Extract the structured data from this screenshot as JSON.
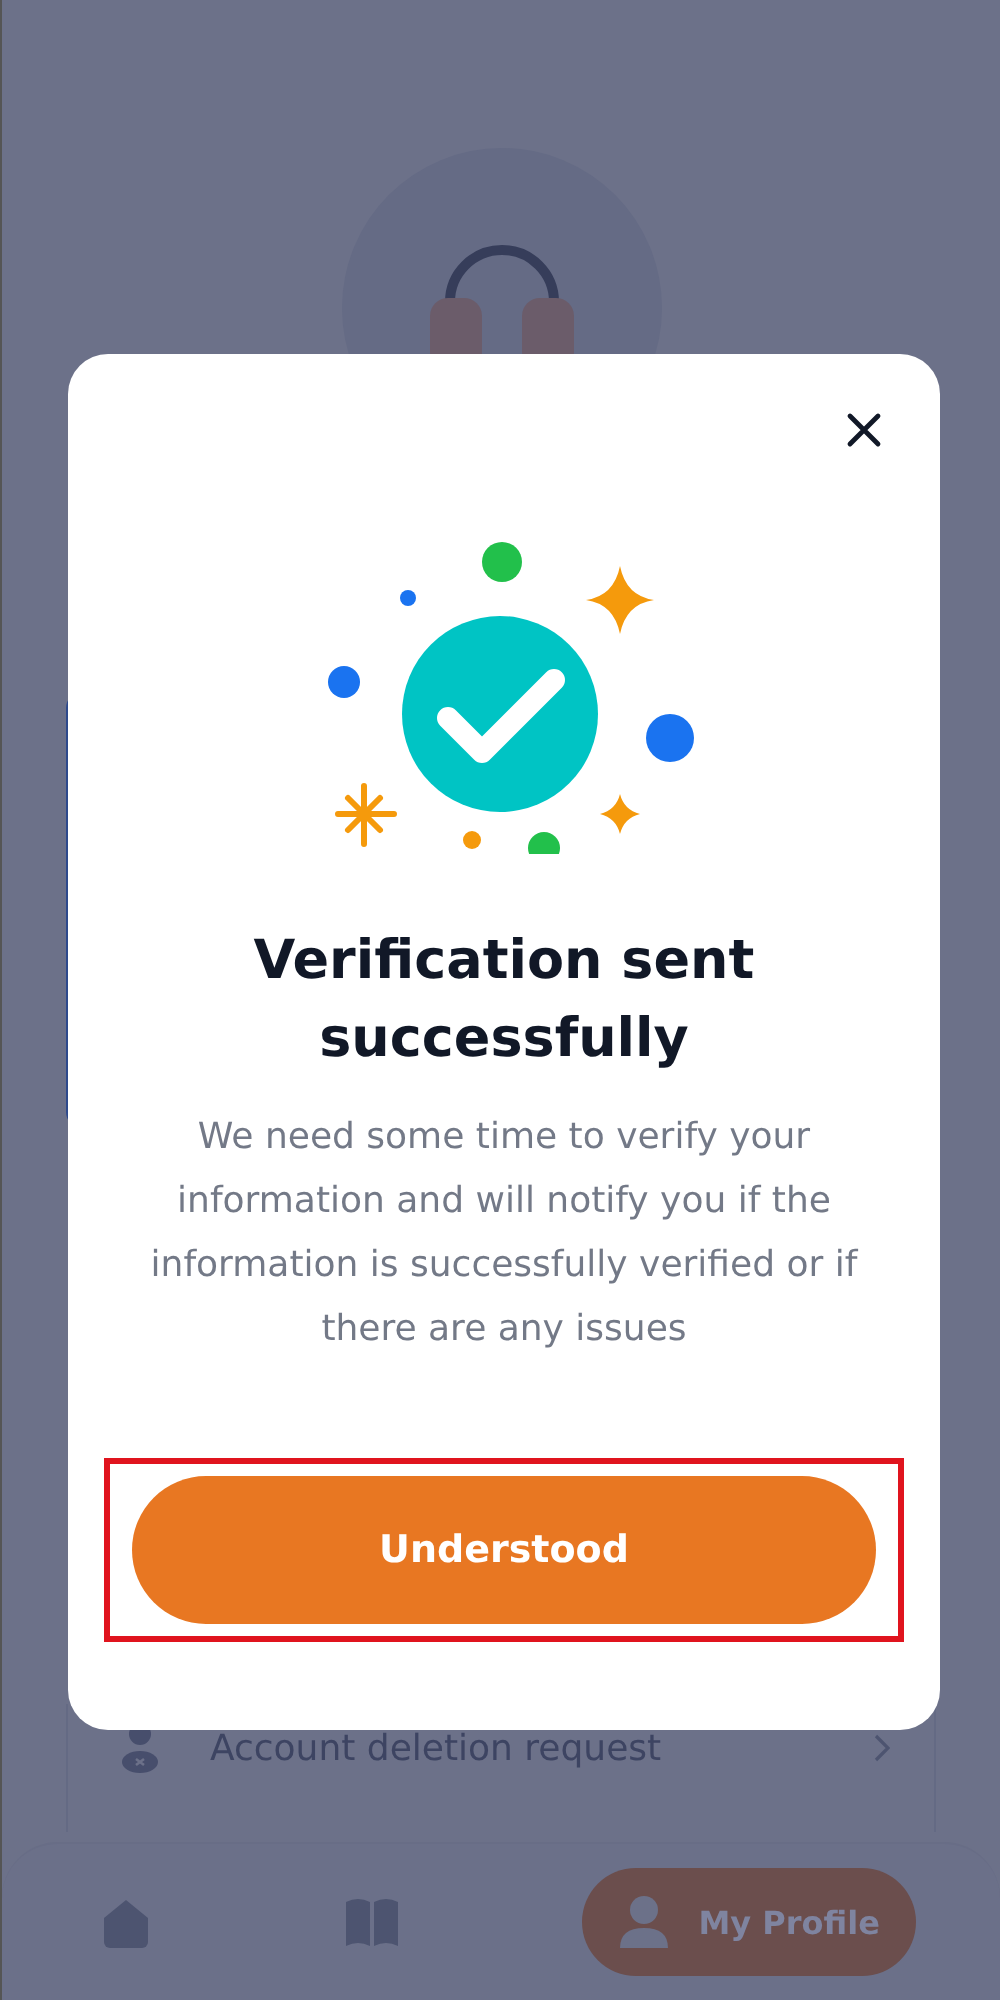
{
  "profile": {
    "menu_items": [
      {
        "label": "Account deletion request"
      }
    ]
  },
  "bottom_nav": {
    "items": [
      {
        "kind": "home",
        "selected": false
      },
      {
        "kind": "book",
        "selected": false
      },
      {
        "kind": "profile",
        "label": "My Profile",
        "selected": true
      }
    ]
  },
  "dialog": {
    "title": "Verification sent successfully",
    "message": "We need some time to verify your information and will notify you if the information is successfully verified or if there are any issues",
    "primary_button": {
      "label": "Understood",
      "highlighted": true
    }
  }
}
